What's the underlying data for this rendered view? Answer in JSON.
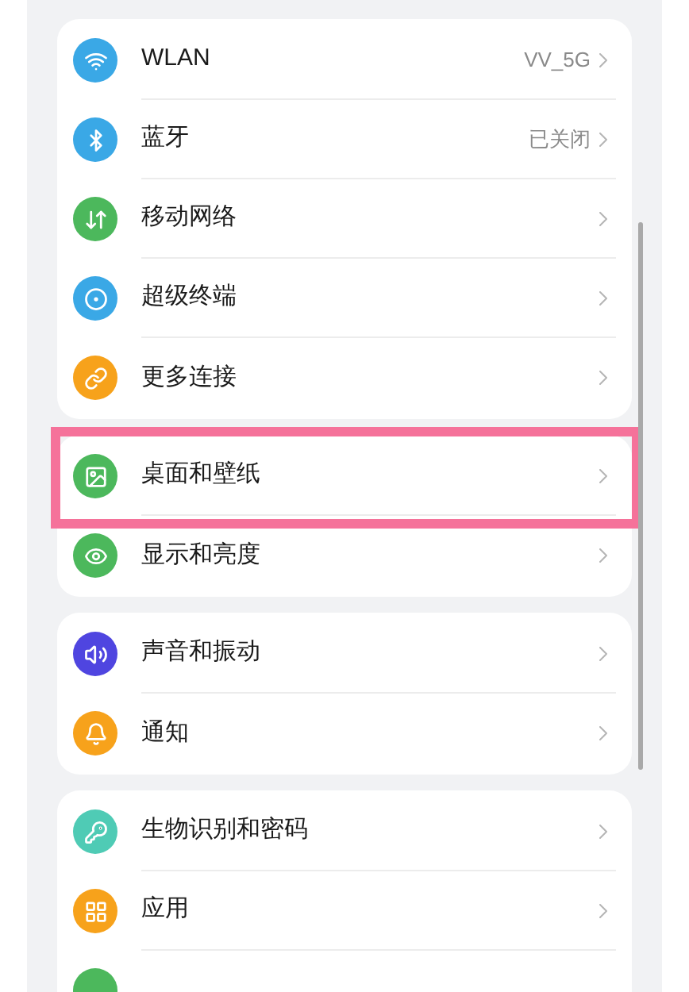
{
  "groups": [
    {
      "items": [
        {
          "kind": "wifi",
          "color": "#3aa8e6",
          "label": "WLAN",
          "value": "VV_5G",
          "highlighted": false
        },
        {
          "kind": "bluetooth",
          "color": "#3aa8e6",
          "label": "蓝牙",
          "value": "已关闭",
          "highlighted": false
        },
        {
          "kind": "mobile",
          "color": "#4cb85c",
          "label": "移动网络",
          "highlighted": false
        },
        {
          "kind": "devices",
          "color": "#3aa8e6",
          "label": "超级终端",
          "highlighted": false
        },
        {
          "kind": "link",
          "color": "#f7a21b",
          "label": "更多连接",
          "highlighted": false
        }
      ]
    },
    {
      "items": [
        {
          "kind": "image",
          "color": "#4cb85c",
          "label": "桌面和壁纸",
          "highlighted": true
        },
        {
          "kind": "eye",
          "color": "#4cb85c",
          "label": "显示和亮度",
          "highlighted": false
        }
      ]
    },
    {
      "items": [
        {
          "kind": "sound",
          "color": "#4f45e0",
          "label": "声音和振动",
          "highlighted": false
        },
        {
          "kind": "bell",
          "color": "#f7a21b",
          "label": "通知",
          "highlighted": false
        }
      ]
    },
    {
      "items": [
        {
          "kind": "key",
          "color": "#4fcbb5",
          "label": "生物识别和密码",
          "highlighted": false
        },
        {
          "kind": "apps",
          "color": "#f7a21b",
          "label": "应用",
          "highlighted": false
        },
        {
          "kind": "plain",
          "color": "#4cb85c"
        }
      ]
    }
  ]
}
